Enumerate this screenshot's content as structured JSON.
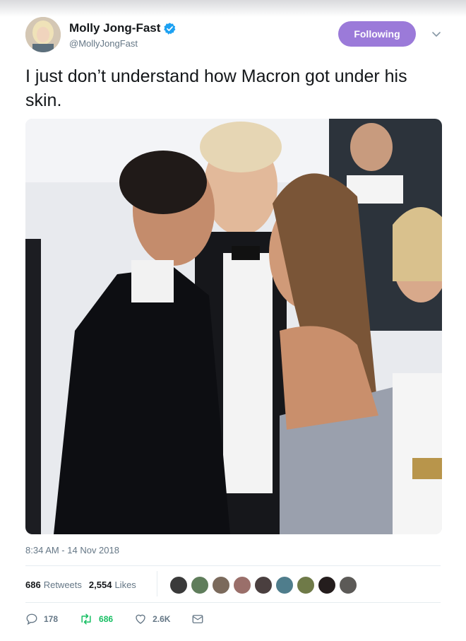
{
  "author": {
    "display_name": "Molly Jong-Fast",
    "handle": "@MollyJongFast",
    "verified": true,
    "avatar_icon": "user-avatar"
  },
  "follow_button": {
    "label": "Following",
    "color": "#9b7ad9"
  },
  "menu_icon": "chevron-down-icon",
  "tweet": {
    "text": "I just don’t understand how Macron got under his skin."
  },
  "media": {
    "kind": "photo"
  },
  "timestamp": "8:34 AM - 14 Nov 2018",
  "stats": {
    "retweets_count": "686",
    "retweets_label": "Retweets",
    "likes_count": "2,554",
    "likes_label": "Likes"
  },
  "likers_count_shown": 9,
  "actions": {
    "reply_count": "178",
    "retweet_count": "686",
    "like_count": "2.6K",
    "reply_icon": "reply-icon",
    "retweet_icon": "retweet-icon",
    "like_icon": "heart-icon",
    "dm_icon": "envelope-icon"
  },
  "colors": {
    "text_primary": "#14171a",
    "text_secondary": "#657786",
    "retweet_active": "#17bf63",
    "verified_badge": "#1da1f2"
  }
}
